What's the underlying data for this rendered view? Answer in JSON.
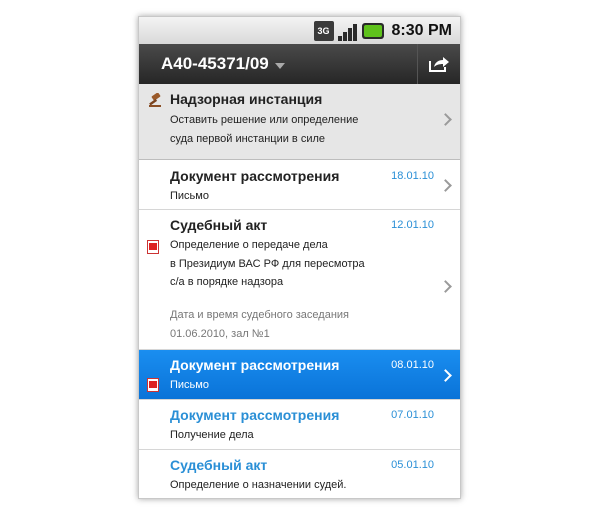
{
  "statusbar": {
    "network": "3G",
    "time": "8:30 PM"
  },
  "titlebar": {
    "title": "А40-45371/09"
  },
  "rows": [
    {
      "title": "Надзорная инстанция",
      "sub": [
        "Оставить решение или определение",
        "суда первой инстанции в силе"
      ]
    },
    {
      "title": "Документ рассмотрения",
      "date": "18.01.10",
      "sub": [
        "Письмо"
      ]
    },
    {
      "title": "Судебный акт",
      "date": "12.01.10",
      "sub": [
        "Определение о передаче дела",
        "в Президиум ВАС РФ для пересмотра",
        "с/а в порядке надзора"
      ],
      "meta": [
        "Дата и время судебного заседания",
        "01.06.2010, зал №1"
      ]
    },
    {
      "title": "Документ рассмотрения",
      "date": "08.01.10",
      "sub": [
        "Письмо"
      ]
    },
    {
      "title": "Документ рассмотрения",
      "date": "07.01.10",
      "sub": [
        "Получение дела"
      ]
    },
    {
      "title": "Судебный акт",
      "date": "05.01.10",
      "sub": [
        "Определение о назначении судей."
      ]
    }
  ],
  "colors": {
    "accent": "#2a8fd6",
    "selected": "#0a7be0",
    "titlebar": "#333333"
  }
}
